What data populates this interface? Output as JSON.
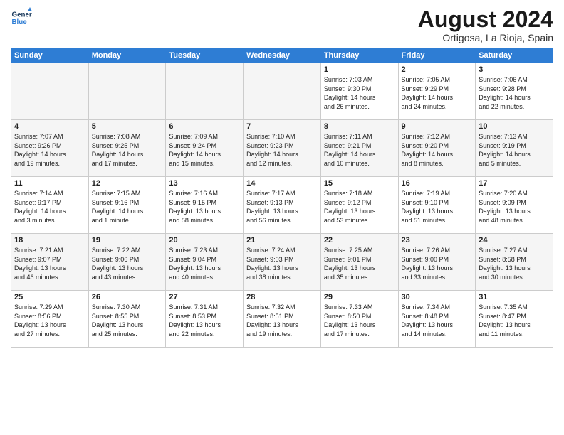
{
  "header": {
    "logo_line1": "General",
    "logo_line2": "Blue",
    "month_title": "August 2024",
    "location": "Ortigosa, La Rioja, Spain"
  },
  "weekdays": [
    "Sunday",
    "Monday",
    "Tuesday",
    "Wednesday",
    "Thursday",
    "Friday",
    "Saturday"
  ],
  "weeks": [
    [
      {
        "day": "",
        "info": ""
      },
      {
        "day": "",
        "info": ""
      },
      {
        "day": "",
        "info": ""
      },
      {
        "day": "",
        "info": ""
      },
      {
        "day": "1",
        "info": "Sunrise: 7:03 AM\nSunset: 9:30 PM\nDaylight: 14 hours\nand 26 minutes."
      },
      {
        "day": "2",
        "info": "Sunrise: 7:05 AM\nSunset: 9:29 PM\nDaylight: 14 hours\nand 24 minutes."
      },
      {
        "day": "3",
        "info": "Sunrise: 7:06 AM\nSunset: 9:28 PM\nDaylight: 14 hours\nand 22 minutes."
      }
    ],
    [
      {
        "day": "4",
        "info": "Sunrise: 7:07 AM\nSunset: 9:26 PM\nDaylight: 14 hours\nand 19 minutes."
      },
      {
        "day": "5",
        "info": "Sunrise: 7:08 AM\nSunset: 9:25 PM\nDaylight: 14 hours\nand 17 minutes."
      },
      {
        "day": "6",
        "info": "Sunrise: 7:09 AM\nSunset: 9:24 PM\nDaylight: 14 hours\nand 15 minutes."
      },
      {
        "day": "7",
        "info": "Sunrise: 7:10 AM\nSunset: 9:23 PM\nDaylight: 14 hours\nand 12 minutes."
      },
      {
        "day": "8",
        "info": "Sunrise: 7:11 AM\nSunset: 9:21 PM\nDaylight: 14 hours\nand 10 minutes."
      },
      {
        "day": "9",
        "info": "Sunrise: 7:12 AM\nSunset: 9:20 PM\nDaylight: 14 hours\nand 8 minutes."
      },
      {
        "day": "10",
        "info": "Sunrise: 7:13 AM\nSunset: 9:19 PM\nDaylight: 14 hours\nand 5 minutes."
      }
    ],
    [
      {
        "day": "11",
        "info": "Sunrise: 7:14 AM\nSunset: 9:17 PM\nDaylight: 14 hours\nand 3 minutes."
      },
      {
        "day": "12",
        "info": "Sunrise: 7:15 AM\nSunset: 9:16 PM\nDaylight: 14 hours\nand 1 minute."
      },
      {
        "day": "13",
        "info": "Sunrise: 7:16 AM\nSunset: 9:15 PM\nDaylight: 13 hours\nand 58 minutes."
      },
      {
        "day": "14",
        "info": "Sunrise: 7:17 AM\nSunset: 9:13 PM\nDaylight: 13 hours\nand 56 minutes."
      },
      {
        "day": "15",
        "info": "Sunrise: 7:18 AM\nSunset: 9:12 PM\nDaylight: 13 hours\nand 53 minutes."
      },
      {
        "day": "16",
        "info": "Sunrise: 7:19 AM\nSunset: 9:10 PM\nDaylight: 13 hours\nand 51 minutes."
      },
      {
        "day": "17",
        "info": "Sunrise: 7:20 AM\nSunset: 9:09 PM\nDaylight: 13 hours\nand 48 minutes."
      }
    ],
    [
      {
        "day": "18",
        "info": "Sunrise: 7:21 AM\nSunset: 9:07 PM\nDaylight: 13 hours\nand 46 minutes."
      },
      {
        "day": "19",
        "info": "Sunrise: 7:22 AM\nSunset: 9:06 PM\nDaylight: 13 hours\nand 43 minutes."
      },
      {
        "day": "20",
        "info": "Sunrise: 7:23 AM\nSunset: 9:04 PM\nDaylight: 13 hours\nand 40 minutes."
      },
      {
        "day": "21",
        "info": "Sunrise: 7:24 AM\nSunset: 9:03 PM\nDaylight: 13 hours\nand 38 minutes."
      },
      {
        "day": "22",
        "info": "Sunrise: 7:25 AM\nSunset: 9:01 PM\nDaylight: 13 hours\nand 35 minutes."
      },
      {
        "day": "23",
        "info": "Sunrise: 7:26 AM\nSunset: 9:00 PM\nDaylight: 13 hours\nand 33 minutes."
      },
      {
        "day": "24",
        "info": "Sunrise: 7:27 AM\nSunset: 8:58 PM\nDaylight: 13 hours\nand 30 minutes."
      }
    ],
    [
      {
        "day": "25",
        "info": "Sunrise: 7:29 AM\nSunset: 8:56 PM\nDaylight: 13 hours\nand 27 minutes."
      },
      {
        "day": "26",
        "info": "Sunrise: 7:30 AM\nSunset: 8:55 PM\nDaylight: 13 hours\nand 25 minutes."
      },
      {
        "day": "27",
        "info": "Sunrise: 7:31 AM\nSunset: 8:53 PM\nDaylight: 13 hours\nand 22 minutes."
      },
      {
        "day": "28",
        "info": "Sunrise: 7:32 AM\nSunset: 8:51 PM\nDaylight: 13 hours\nand 19 minutes."
      },
      {
        "day": "29",
        "info": "Sunrise: 7:33 AM\nSunset: 8:50 PM\nDaylight: 13 hours\nand 17 minutes."
      },
      {
        "day": "30",
        "info": "Sunrise: 7:34 AM\nSunset: 8:48 PM\nDaylight: 13 hours\nand 14 minutes."
      },
      {
        "day": "31",
        "info": "Sunrise: 7:35 AM\nSunset: 8:47 PM\nDaylight: 13 hours\nand 11 minutes."
      }
    ]
  ]
}
